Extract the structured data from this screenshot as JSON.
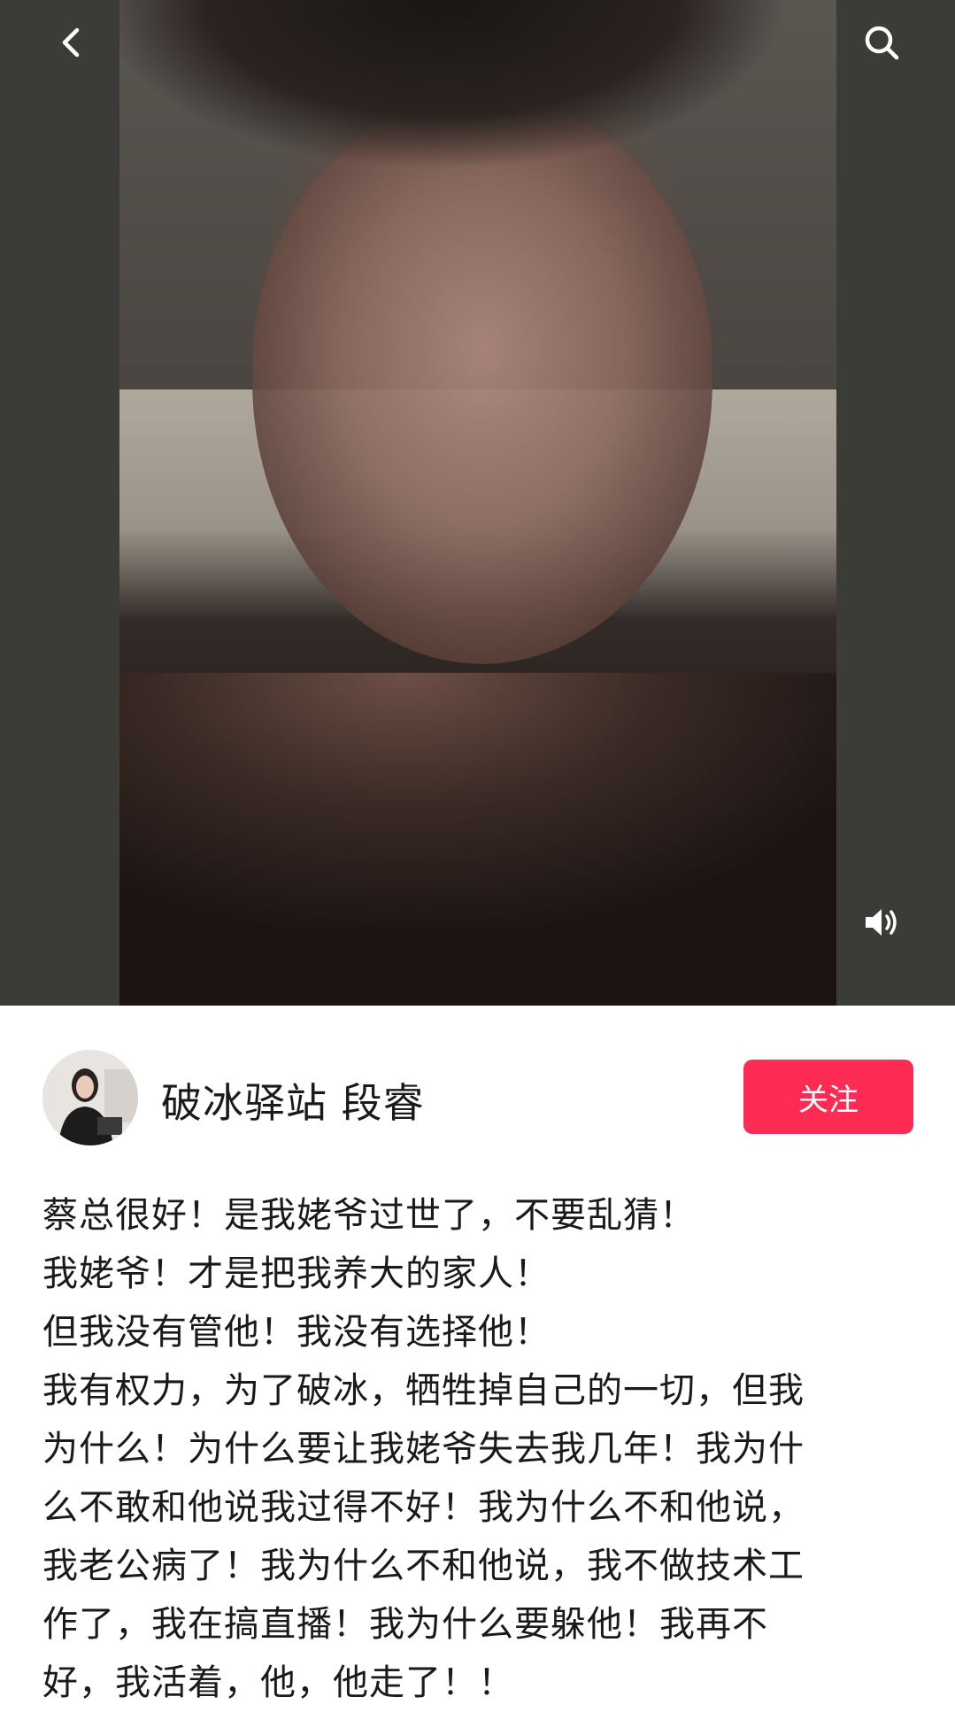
{
  "author": {
    "name": "破冰驿站 段睿",
    "follow_label": "关注"
  },
  "caption_lines": [
    "蔡总很好！是我姥爷过世了，不要乱猜！",
    "我姥爷！才是把我养大的家人！",
    "但我没有管他！我没有选择他！",
    "我有权力，为了破冰，牺牲掉自己的一切，但我",
    "为什么！为什么要让我姥爷失去我几年！我为什",
    "么不敢和他说我过得不好！我为什么不和他说，",
    "我老公病了！我为什么不和他说，我不做技术工",
    "作了，我在搞直播！我为什么要躲他！我再不",
    "好，我活着，他，他走了！！"
  ],
  "icons": {
    "back": "chevron-left-icon",
    "search": "search-icon",
    "volume": "volume-icon"
  },
  "colors": {
    "follow_button": "#fe2c55",
    "video_background": "#3b3b38"
  }
}
